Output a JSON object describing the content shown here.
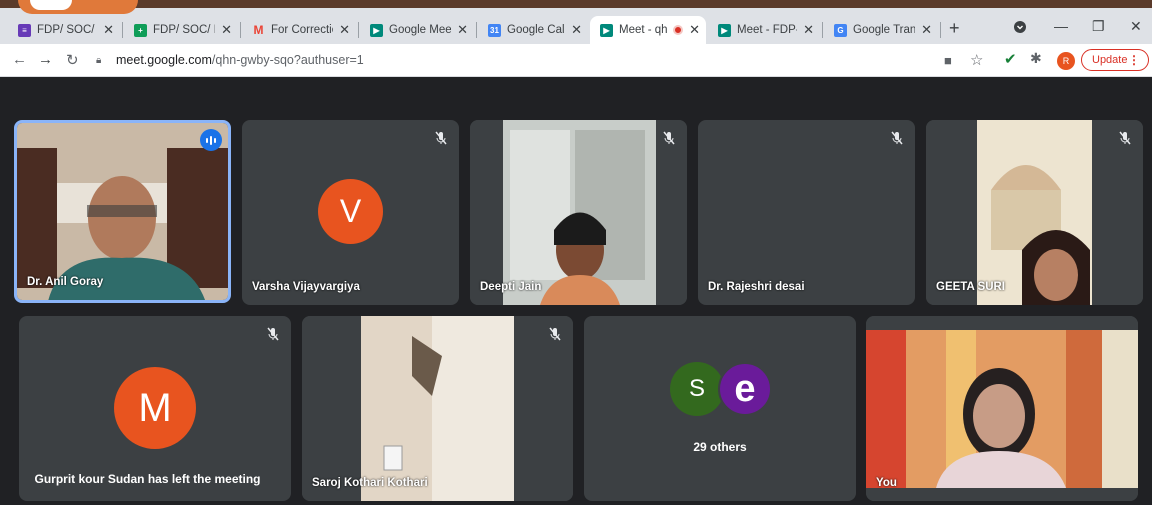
{
  "browser": {
    "tabs": [
      {
        "title": "FDP/ SOC/ DA",
        "favicon": "forms-icon",
        "color": "#673ab7"
      },
      {
        "title": "FDP/ SOC/ DA",
        "favicon": "sheets-icon",
        "color": "#0f9d58"
      },
      {
        "title": "For Correction",
        "favicon": "gmail-icon",
        "color": "#ea4335"
      },
      {
        "title": "Google Meet",
        "favicon": "meet-icon",
        "color": "#00897b"
      },
      {
        "title": "Google Calend",
        "favicon": "calendar-icon",
        "color": "#4285f4"
      },
      {
        "title": "Meet - qh",
        "favicon": "meet-icon",
        "color": "#00897b",
        "active": true,
        "recording": true
      },
      {
        "title": "Meet - FDP- S",
        "favicon": "meet-icon",
        "color": "#00897b"
      },
      {
        "title": "Google Transl",
        "favicon": "translate-icon",
        "color": "#4285f4"
      }
    ],
    "url_host": "meet.google.com",
    "url_path": "/qhn-gwby-sqo?authuser=1",
    "profile_initial": "R",
    "update_label": "Update"
  },
  "meet": {
    "participants": [
      {
        "name": "Dr. Anil Goray",
        "type": "video",
        "speaking": true
      },
      {
        "name": "Varsha Vijayvargiya",
        "type": "avatar",
        "initial": "V",
        "color": "#e8541f",
        "muted": true
      },
      {
        "name": "Deepti Jain",
        "type": "video",
        "muted": true
      },
      {
        "name": "Dr. Rajeshri desai",
        "type": "blank",
        "muted": true
      },
      {
        "name": "GEETA SURI",
        "type": "video",
        "muted": true
      },
      {
        "name": "",
        "type": "avatar",
        "initial": "M",
        "color": "#e8541f",
        "muted": true
      },
      {
        "name": "Saroj Kothari Kothari",
        "type": "video",
        "muted": true
      },
      {
        "name": "29 others",
        "type": "group",
        "initials": [
          "S",
          "e"
        ],
        "colors": [
          "#33691e",
          "#6a1b9a"
        ]
      },
      {
        "name": "You",
        "type": "video"
      }
    ],
    "toast": "Gurprit kour Sudan has left the meeting"
  }
}
